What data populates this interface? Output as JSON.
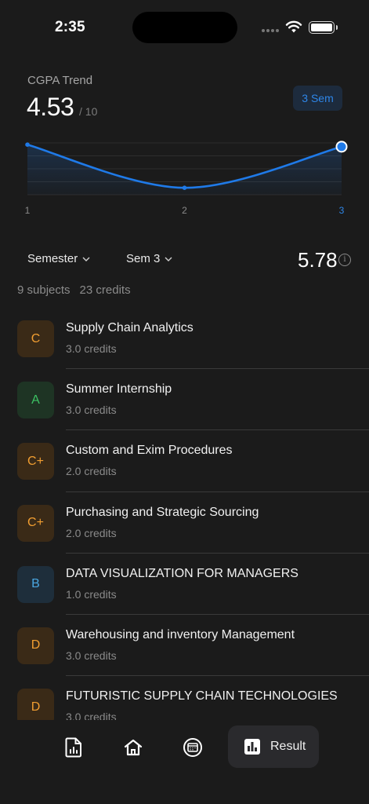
{
  "status_bar": {
    "time": "2:35"
  },
  "trend": {
    "title": "CGPA Trend",
    "value": "4.53",
    "scale": "/ 10",
    "badge": "3 Sem"
  },
  "chart_data": {
    "type": "line",
    "title": "CGPA Trend",
    "x": [
      1,
      2,
      3
    ],
    "tick_labels": [
      "1",
      "2",
      "3"
    ],
    "series": [
      {
        "values": [
          5.9,
          3.4,
          5.78
        ]
      }
    ],
    "highlight_index": 2,
    "ylim": [
      3.0,
      6.0
    ],
    "grid": true,
    "line_color": "#1f7ae8",
    "active_tick_color": "#2e86e8"
  },
  "filters": {
    "type_label": "Semester",
    "semester_label": "Sem 3",
    "gpa": "5.78"
  },
  "summary": {
    "subjects": "9 subjects",
    "credits": "23 credits"
  },
  "subjects": [
    {
      "grade": "C",
      "name": "Supply Chain Analytics",
      "credits": "3.0 credits",
      "tone": "c"
    },
    {
      "grade": "A",
      "name": "Summer Internship",
      "credits": "3.0 credits",
      "tone": "a"
    },
    {
      "grade": "C+",
      "name": "Custom and Exim Procedures",
      "credits": "2.0 credits",
      "tone": "c"
    },
    {
      "grade": "C+",
      "name": "Purchasing and Strategic Sourcing",
      "credits": "2.0 credits",
      "tone": "c"
    },
    {
      "grade": "B",
      "name": "DATA VISUALIZATION FOR MANAGERS",
      "credits": "1.0 credits",
      "tone": "b"
    },
    {
      "grade": "D",
      "name": "Warehousing and inventory Management",
      "credits": "3.0 credits",
      "tone": "c"
    },
    {
      "grade": "D",
      "name": "FUTURISTIC SUPPLY CHAIN TECHNOLOGIES",
      "credits": "3.0 credits",
      "tone": "c"
    }
  ],
  "tab_bar": {
    "items": [
      {
        "icon": "report-icon"
      },
      {
        "icon": "home-icon"
      },
      {
        "icon": "calendar-icon"
      }
    ],
    "active": {
      "icon": "bar-chart-icon",
      "label": "Result"
    }
  },
  "colors": {
    "background": "#1b1b1b",
    "accent": "#1f7ae8",
    "grade_c": "#f19e31",
    "grade_a": "#3cc163",
    "grade_b": "#4aa6e0"
  }
}
